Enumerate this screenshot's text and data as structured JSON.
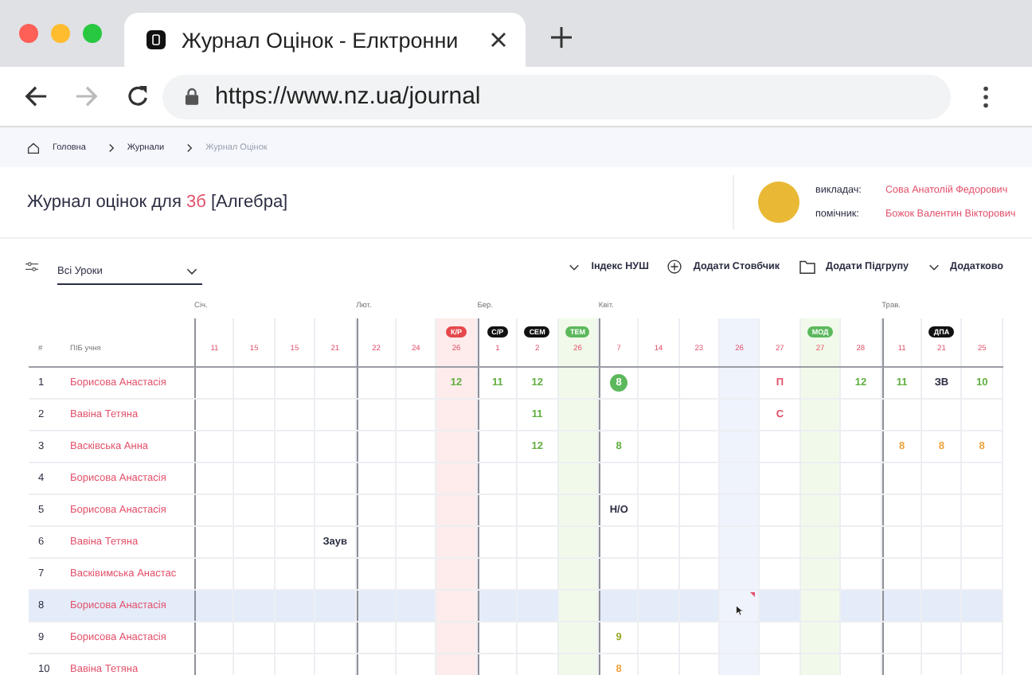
{
  "browser": {
    "tab_title": "Журнал Оцінок - Елктронни",
    "url": "https://www.nz.ua/journal"
  },
  "breadcrumbs": [
    {
      "label": "Головна",
      "current": false
    },
    {
      "label": "Журнали",
      "current": false
    },
    {
      "label": "Журнал Оцінок",
      "current": true
    }
  ],
  "header": {
    "title_prefix": "Журнал оцінок для",
    "class_name": "3б",
    "subject": "[Алгебра]",
    "staff": [
      {
        "role": "викладач:",
        "name": "Сова Анатолій Федорович"
      },
      {
        "role": "помічник:",
        "name": "Божок Валентин Вікторович"
      }
    ]
  },
  "toolbar": {
    "lesson_filter": "Всі Уроки",
    "actions": [
      {
        "kind": "dropdown",
        "label": "Індекс НУШ"
      },
      {
        "kind": "add",
        "label": "Додати Стовбчик"
      },
      {
        "kind": "folder",
        "label": "Додати Підгрупу"
      },
      {
        "kind": "dropdown",
        "label": "Додатково"
      }
    ]
  },
  "table": {
    "number_header": "#",
    "name_header": "ПІБ учня",
    "columns": [
      {
        "date": "11",
        "month": "Січ."
      },
      {
        "date": "15"
      },
      {
        "date": "15"
      },
      {
        "date": "21"
      },
      {
        "date": "22",
        "month": "Лют."
      },
      {
        "date": "24"
      },
      {
        "date": "26",
        "badge": {
          "text": "К/Р",
          "color": "#e5484d"
        },
        "color": "#fdeceb"
      },
      {
        "date": "1",
        "month": "Бер.",
        "badge": {
          "text": "С/Р",
          "color": "#111111"
        }
      },
      {
        "date": "2",
        "badge": {
          "text": "СЕМ",
          "color": "#111111"
        }
      },
      {
        "date": "26",
        "badge": {
          "text": "ТЕМ",
          "color": "#5cb85c"
        },
        "color": "#f1faea"
      },
      {
        "date": "7",
        "month": "Квіт."
      },
      {
        "date": "14"
      },
      {
        "date": "23"
      },
      {
        "date": "26",
        "color": "#eef3fc"
      },
      {
        "date": "27"
      },
      {
        "date": "27",
        "badge": {
          "text": "МОД",
          "color": "#5cb85c"
        },
        "color": "#f1faea"
      },
      {
        "date": "28"
      },
      {
        "date": "11",
        "month": "Трав."
      },
      {
        "date": "21",
        "badge": {
          "text": "ДПА",
          "color": "#111111"
        }
      },
      {
        "date": "25"
      }
    ],
    "rows": [
      {
        "number": "1",
        "name": "Борисова Анастасія",
        "selected": false,
        "cells": [
          {
            "kind": "empty"
          },
          {
            "kind": "empty"
          },
          {
            "kind": "empty"
          },
          {
            "kind": "empty"
          },
          {
            "kind": "empty"
          },
          {
            "kind": "empty"
          },
          {
            "kind": "plain",
            "text": "12",
            "color": "#5fae3e"
          },
          {
            "kind": "plain",
            "text": "11",
            "color": "#5fae3e"
          },
          {
            "kind": "plain",
            "text": "12",
            "color": "#5fae3e"
          },
          {
            "kind": "empty"
          },
          {
            "kind": "circle",
            "text": "8",
            "color": "#5cb85c"
          },
          {
            "kind": "empty"
          },
          {
            "kind": "empty"
          },
          {
            "kind": "empty"
          },
          {
            "kind": "plain",
            "text": "П",
            "color": "#e2506a"
          },
          {
            "kind": "empty"
          },
          {
            "kind": "plain",
            "text": "12",
            "color": "#5fae3e"
          },
          {
            "kind": "plain",
            "text": "11",
            "color": "#5fae3e"
          },
          {
            "kind": "plain",
            "text": "ЗВ",
            "color": "#2b2d42"
          },
          {
            "kind": "plain",
            "text": "10",
            "color": "#5fae3e"
          }
        ]
      },
      {
        "number": "2",
        "name": "Вавіна Тетяна",
        "selected": false,
        "cells": [
          {
            "kind": "empty"
          },
          {
            "kind": "empty"
          },
          {
            "kind": "empty"
          },
          {
            "kind": "empty"
          },
          {
            "kind": "empty"
          },
          {
            "kind": "empty"
          },
          {
            "kind": "empty"
          },
          {
            "kind": "empty"
          },
          {
            "kind": "plain",
            "text": "11",
            "color": "#5fae3e"
          },
          {
            "kind": "empty"
          },
          {
            "kind": "empty"
          },
          {
            "kind": "empty"
          },
          {
            "kind": "empty"
          },
          {
            "kind": "empty"
          },
          {
            "kind": "plain",
            "text": "С",
            "color": "#e2506a"
          },
          {
            "kind": "empty"
          },
          {
            "kind": "empty"
          },
          {
            "kind": "empty"
          },
          {
            "kind": "empty"
          },
          {
            "kind": "empty"
          }
        ]
      },
      {
        "number": "3",
        "name": "Васківська Анна",
        "selected": false,
        "cells": [
          {
            "kind": "empty"
          },
          {
            "kind": "empty"
          },
          {
            "kind": "empty"
          },
          {
            "kind": "empty"
          },
          {
            "kind": "empty"
          },
          {
            "kind": "empty"
          },
          {
            "kind": "empty"
          },
          {
            "kind": "empty"
          },
          {
            "kind": "plain",
            "text": "12",
            "color": "#5fae3e"
          },
          {
            "kind": "empty"
          },
          {
            "kind": "plain",
            "text": "8",
            "color": "#5fae3e"
          },
          {
            "kind": "empty"
          },
          {
            "kind": "empty"
          },
          {
            "kind": "empty"
          },
          {
            "kind": "empty"
          },
          {
            "kind": "empty"
          },
          {
            "kind": "empty"
          },
          {
            "kind": "plain",
            "text": "8",
            "color": "#f0a23c"
          },
          {
            "kind": "plain",
            "text": "8",
            "color": "#f0a23c"
          },
          {
            "kind": "plain",
            "text": "8",
            "color": "#f0a23c"
          }
        ]
      },
      {
        "number": "4",
        "name": "Борисова Анастасія",
        "selected": false
      },
      {
        "number": "5",
        "name": "Борисова Анастасія",
        "selected": false,
        "cells": [
          {
            "kind": "empty"
          },
          {
            "kind": "empty"
          },
          {
            "kind": "empty"
          },
          {
            "kind": "empty"
          },
          {
            "kind": "empty"
          },
          {
            "kind": "empty"
          },
          {
            "kind": "empty"
          },
          {
            "kind": "empty"
          },
          {
            "kind": "empty"
          },
          {
            "kind": "empty"
          },
          {
            "kind": "plain",
            "text": "Н/О",
            "color": "#2b2d42"
          }
        ]
      },
      {
        "number": "6",
        "name": "Вавіна Тетяна",
        "selected": false,
        "cells": [
          {
            "kind": "empty"
          },
          {
            "kind": "empty"
          },
          {
            "kind": "empty"
          },
          {
            "kind": "plain",
            "text": "Заув",
            "color": "#2b2d42"
          }
        ]
      },
      {
        "number": "7",
        "name": "Васківимська Анастас",
        "selected": false
      },
      {
        "number": "8",
        "name": "Борисова Анастасія",
        "selected": true,
        "cells": [
          {
            "kind": "empty"
          },
          {
            "kind": "empty"
          },
          {
            "kind": "empty"
          },
          {
            "kind": "empty"
          },
          {
            "kind": "empty"
          },
          {
            "kind": "empty"
          },
          {
            "kind": "empty"
          },
          {
            "kind": "empty"
          },
          {
            "kind": "empty"
          },
          {
            "kind": "empty"
          },
          {
            "kind": "empty"
          },
          {
            "kind": "empty"
          },
          {
            "kind": "empty"
          },
          {
            "kind": "note",
            "color": "#e2506a",
            "hovered": true
          }
        ]
      },
      {
        "number": "9",
        "name": "Борисова Анастасія",
        "selected": false,
        "cells": [
          {
            "kind": "empty"
          },
          {
            "kind": "empty"
          },
          {
            "kind": "empty"
          },
          {
            "kind": "empty"
          },
          {
            "kind": "empty"
          },
          {
            "kind": "empty"
          },
          {
            "kind": "empty"
          },
          {
            "kind": "empty"
          },
          {
            "kind": "empty"
          },
          {
            "kind": "empty"
          },
          {
            "kind": "plain",
            "text": "9",
            "color": "#9aab2c"
          }
        ]
      },
      {
        "number": "10",
        "name": "Вавіна Тетяна",
        "selected": false,
        "cells": [
          {
            "kind": "empty"
          },
          {
            "kind": "empty"
          },
          {
            "kind": "empty"
          },
          {
            "kind": "empty"
          },
          {
            "kind": "empty"
          },
          {
            "kind": "empty"
          },
          {
            "kind": "empty"
          },
          {
            "kind": "empty"
          },
          {
            "kind": "empty"
          },
          {
            "kind": "empty"
          },
          {
            "kind": "plain",
            "text": "8",
            "color": "#f0a23c"
          }
        ]
      }
    ]
  }
}
